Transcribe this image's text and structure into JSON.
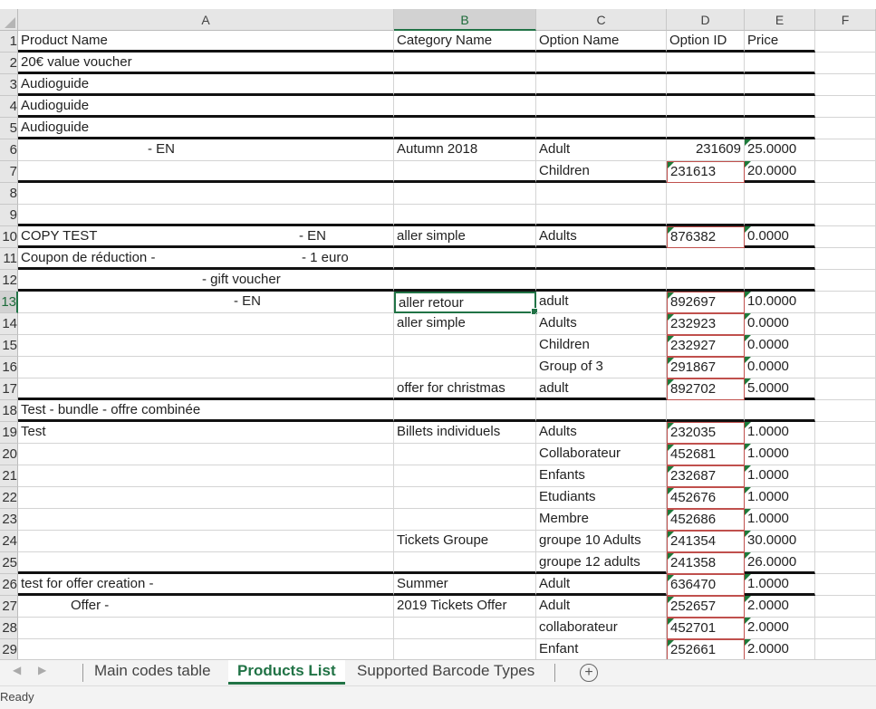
{
  "columns": [
    {
      "letter": "A",
      "selected": false
    },
    {
      "letter": "B",
      "selected": true
    },
    {
      "letter": "C",
      "selected": false
    },
    {
      "letter": "D",
      "selected": false
    },
    {
      "letter": "E",
      "selected": false
    },
    {
      "letter": "F",
      "selected": false
    }
  ],
  "rows": [
    {
      "num": "1",
      "a": "Product Name",
      "b": "Category Name",
      "c": "Option Name",
      "d": "Option ID",
      "e": "Price"
    },
    {
      "num": "2",
      "a": "20€ value voucher",
      "b": "",
      "c": "",
      "d": "",
      "e": ""
    },
    {
      "num": "3",
      "a": "Audioguide",
      "b": "",
      "c": "",
      "d": "",
      "e": ""
    },
    {
      "num": "4",
      "a": "Audioguide",
      "b": "",
      "c": "",
      "d": "",
      "e": ""
    },
    {
      "num": "5",
      "a": "Audioguide",
      "b": "",
      "c": "",
      "d": "",
      "e": ""
    },
    {
      "num": "6",
      "a": "- EN",
      "b": "Autumn 2018",
      "c": "Adult",
      "d": "231609",
      "e": "25.0000"
    },
    {
      "num": "7",
      "a": "",
      "b": "",
      "c": "Children",
      "d": "231613",
      "e": "20.0000"
    },
    {
      "num": "8",
      "a": "",
      "b": "",
      "c": "",
      "d": "",
      "e": ""
    },
    {
      "num": "9",
      "a": "",
      "b": "",
      "c": "",
      "d": "",
      "e": ""
    },
    {
      "num": "10",
      "a": "COPY TEST",
      "a2": "- EN",
      "b": "aller simple",
      "c": "Adults",
      "d": "876382",
      "e": "0.0000"
    },
    {
      "num": "11",
      "a": "Coupon de réduction -",
      "a2": "- 1 euro",
      "b": "",
      "c": "",
      "d": "",
      "e": ""
    },
    {
      "num": "12",
      "a": "- gift voucher",
      "b": "",
      "c": "",
      "d": "",
      "e": ""
    },
    {
      "num": "13",
      "a": "- EN",
      "b": "aller retour",
      "c": "adult",
      "d": "892697",
      "e": "10.0000"
    },
    {
      "num": "14",
      "a": "",
      "b": "aller simple",
      "c": "Adults",
      "d": "232923",
      "e": "0.0000"
    },
    {
      "num": "15",
      "a": "",
      "b": "",
      "c": "Children",
      "d": "232927",
      "e": "0.0000"
    },
    {
      "num": "16",
      "a": "",
      "b": "",
      "c": "Group of 3",
      "d": "291867",
      "e": "0.0000"
    },
    {
      "num": "17",
      "a": "",
      "b": "offer for christmas",
      "c": "adult",
      "d": "892702",
      "e": "5.0000"
    },
    {
      "num": "18",
      "a": "Test - bundle - offre combinée",
      "b": "",
      "c": "",
      "d": "",
      "e": ""
    },
    {
      "num": "19",
      "a": "Test",
      "b": "Billets individuels",
      "c": "Adults",
      "d": "232035",
      "e": "1.0000"
    },
    {
      "num": "20",
      "a": "",
      "b": "",
      "c": "Collaborateur",
      "d": "452681",
      "e": "1.0000"
    },
    {
      "num": "21",
      "a": "",
      "b": "",
      "c": "Enfants",
      "d": "232687",
      "e": "1.0000"
    },
    {
      "num": "22",
      "a": "",
      "b": "",
      "c": "Etudiants",
      "d": "452676",
      "e": "1.0000"
    },
    {
      "num": "23",
      "a": "",
      "b": "",
      "c": "Membre",
      "d": "452686",
      "e": "1.0000"
    },
    {
      "num": "24",
      "a": "",
      "b": "Tickets Groupe",
      "c": "groupe 10 Adults",
      "d": "241354",
      "e": "30.0000"
    },
    {
      "num": "25",
      "a": "",
      "b": "",
      "c": "groupe 12 adults",
      "d": "241358",
      "e": "26.0000"
    },
    {
      "num": "26",
      "a": "test for offer creation -",
      "b": "Summer",
      "c": "Adult",
      "d": "636470",
      "e": "1.0000"
    },
    {
      "num": "27",
      "a": "Offer -",
      "b": "2019 Tickets Offer",
      "c": "Adult",
      "d": "252657",
      "e": "2.0000"
    },
    {
      "num": "28",
      "a": "",
      "b": "",
      "c": "collaborateur",
      "d": "452701",
      "e": "2.0000"
    },
    {
      "num": "29",
      "a": "",
      "b": "",
      "c": "Enfant",
      "d": "252661",
      "e": "2.0000"
    }
  ],
  "tabs": [
    {
      "label": "Main codes table",
      "active": false
    },
    {
      "label": "Products List",
      "active": true
    },
    {
      "label": "Supported Barcode Types",
      "active": false
    }
  ],
  "status": "Ready",
  "colors": {
    "accent": "#217346",
    "error_marker": "#c0504d",
    "indicator": "#1e7a3a"
  }
}
